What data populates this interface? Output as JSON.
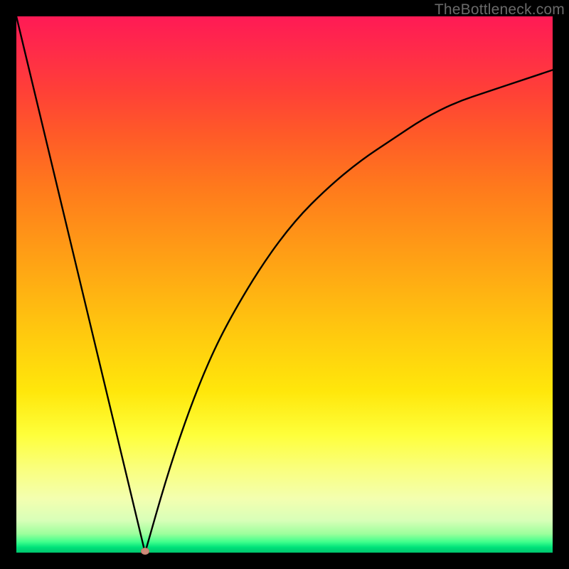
{
  "attribution": "TheBottleneck.com",
  "chart_data": {
    "type": "line",
    "title": "",
    "xlabel": "",
    "ylabel": "",
    "xlim": [
      0,
      100
    ],
    "ylim": [
      0,
      100
    ],
    "notes": "Gradient background red→green top-to-bottom. Single black V-shaped curve with its minimum near x≈24 at y≈0; left side is steep/linear from (0,100) to (24,0); right side rises as a concave curve toward ~(100,90). Small salmon dot marks the minimum.",
    "series": [
      {
        "name": "curve",
        "x": [
          0,
          6,
          12,
          18,
          24,
          28,
          32,
          36,
          40,
          46,
          52,
          58,
          64,
          70,
          76,
          82,
          88,
          94,
          100
        ],
        "y": [
          100,
          75,
          50,
          25,
          0,
          14,
          26,
          36,
          44,
          54,
          62,
          68,
          73,
          77,
          81,
          84,
          86,
          88,
          90
        ]
      }
    ],
    "marker": {
      "x": 24,
      "y": 0,
      "color": "#d08a7a"
    },
    "background_gradient": {
      "stops": [
        {
          "pos": 0.0,
          "color": "#ff1a55"
        },
        {
          "pos": 0.32,
          "color": "#ff7a1c"
        },
        {
          "pos": 0.58,
          "color": "#ffc60f"
        },
        {
          "pos": 0.78,
          "color": "#feff3a"
        },
        {
          "pos": 0.94,
          "color": "#d8ffb8"
        },
        {
          "pos": 1.0,
          "color": "#00c46e"
        }
      ]
    }
  }
}
